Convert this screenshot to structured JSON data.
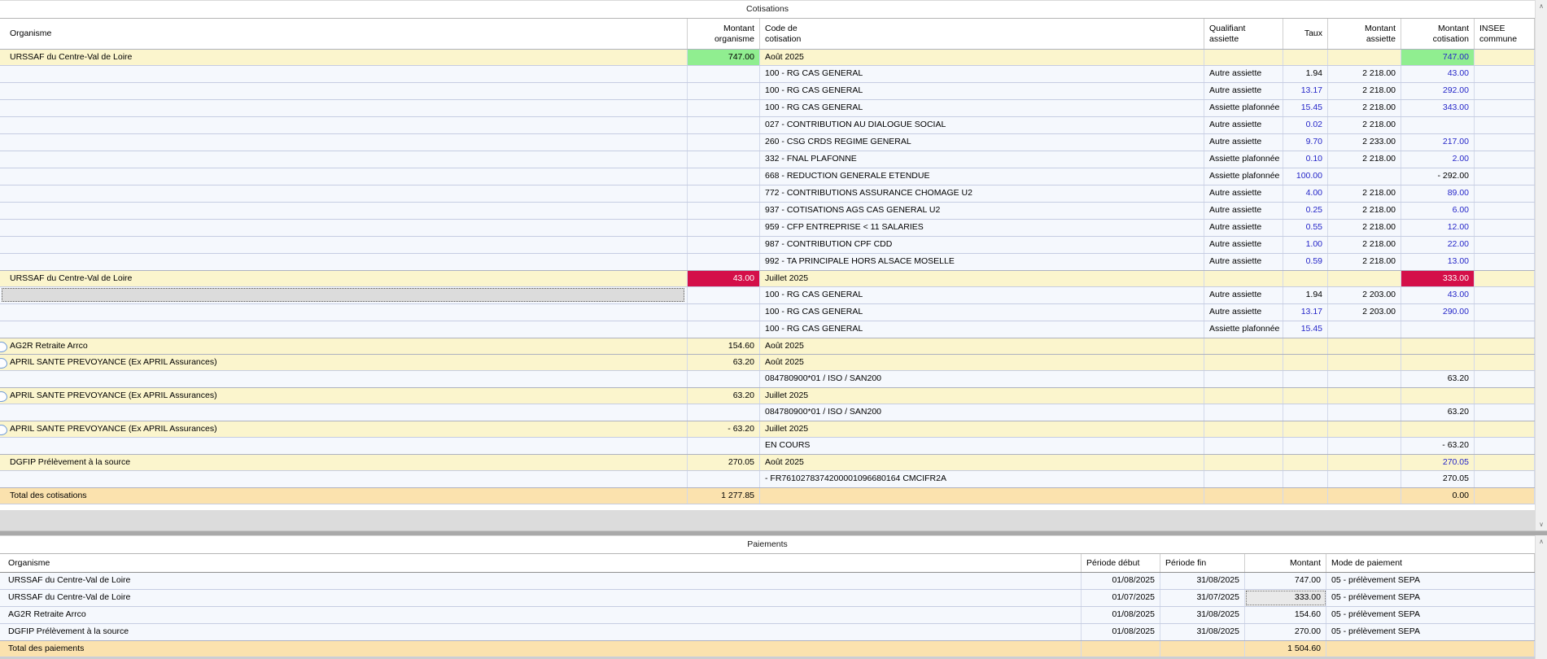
{
  "palette": {
    "group_row_bg": "#fbf5cd",
    "detail_row_bg": "#f5f8fd",
    "total_row_bg": "#fbe2ae",
    "highlight_green": "#90ee90",
    "highlight_red": "#d40f49",
    "number_blue": "#2425c8",
    "selected_cell_bg": "#dcdcdc",
    "row_border": "#c6cde2",
    "cell_border": "#d3d9ea"
  },
  "icons": {
    "scroll_up": "∧",
    "scroll_down": "∨"
  },
  "cotisations": {
    "title": "Cotisations",
    "headers": {
      "organisme": "Organisme",
      "montant_organisme": "Montant\norganisme",
      "code": "Code de\ncotisation",
      "qualifiant": "Qualifiant\nassiette",
      "taux": "Taux",
      "montant_assiette": "Montant\nassiette",
      "montant_cotisation": "Montant\ncotisation",
      "insee": "INSEE\ncommune"
    },
    "rows": [
      {
        "kind": "group",
        "organisme": "URSSAF du Centre-Val de Loire",
        "montant_organisme": "747.00",
        "mo_hl": "green",
        "code": "Août 2025",
        "montant_cotisation": "747.00",
        "mc_hl": "green",
        "mc_blue": true
      },
      {
        "kind": "detail",
        "code": "100 - RG CAS GENERAL",
        "qualifiant": "Autre assiette",
        "taux": "1.94",
        "montant_assiette": "2 218.00",
        "montant_cotisation": "43.00",
        "mc_blue": true
      },
      {
        "kind": "detail",
        "code": "100 - RG CAS GENERAL",
        "qualifiant": "Autre assiette",
        "taux": "13.17",
        "taux_blue": true,
        "montant_assiette": "2 218.00",
        "montant_cotisation": "292.00",
        "mc_blue": true
      },
      {
        "kind": "detail",
        "code": "100 - RG CAS GENERAL",
        "qualifiant": "Assiette plafonnée",
        "taux": "15.45",
        "taux_blue": true,
        "montant_assiette": "2 218.00",
        "montant_cotisation": "343.00",
        "mc_blue": true
      },
      {
        "kind": "detail",
        "code": "027 - CONTRIBUTION AU DIALOGUE SOCIAL",
        "qualifiant": "Autre assiette",
        "taux": "0.02",
        "taux_blue": true,
        "montant_assiette": "2 218.00"
      },
      {
        "kind": "detail",
        "code": "260 - CSG CRDS REGIME GENERAL",
        "qualifiant": "Autre assiette",
        "taux": "9.70",
        "taux_blue": true,
        "montant_assiette": "2 233.00",
        "montant_cotisation": "217.00",
        "mc_blue": true
      },
      {
        "kind": "detail",
        "code": "332 - FNAL PLAFONNE",
        "qualifiant": "Assiette plafonnée",
        "taux": "0.10",
        "taux_blue": true,
        "montant_assiette": "2 218.00",
        "montant_cotisation": "2.00",
        "mc_blue": true
      },
      {
        "kind": "detail",
        "code": "668 - REDUCTION GENERALE ETENDUE",
        "qualifiant": "Assiette plafonnée",
        "taux": "100.00",
        "taux_blue": true,
        "montant_cotisation": "- 292.00"
      },
      {
        "kind": "detail",
        "code": "772 - CONTRIBUTIONS ASSURANCE CHOMAGE U2",
        "qualifiant": "Autre assiette",
        "taux": "4.00",
        "taux_blue": true,
        "montant_assiette": "2 218.00",
        "montant_cotisation": "89.00",
        "mc_blue": true
      },
      {
        "kind": "detail",
        "code": "937 - COTISATIONS AGS CAS GENERAL U2",
        "qualifiant": "Autre assiette",
        "taux": "0.25",
        "taux_blue": true,
        "montant_assiette": "2 218.00",
        "montant_cotisation": "6.00",
        "mc_blue": true
      },
      {
        "kind": "detail",
        "code": "959 - CFP ENTREPRISE < 11 SALARIES",
        "qualifiant": "Autre assiette",
        "taux": "0.55",
        "taux_blue": true,
        "montant_assiette": "2 218.00",
        "montant_cotisation": "12.00",
        "mc_blue": true
      },
      {
        "kind": "detail",
        "code": "987 - CONTRIBUTION CPF CDD",
        "qualifiant": "Autre assiette",
        "taux": "1.00",
        "taux_blue": true,
        "montant_assiette": "2 218.00",
        "montant_cotisation": "22.00",
        "mc_blue": true
      },
      {
        "kind": "detail",
        "code": "992 - TA PRINCIPALE HORS ALSACE MOSELLE",
        "qualifiant": "Autre assiette",
        "taux": "0.59",
        "taux_blue": true,
        "montant_assiette": "2 218.00",
        "montant_cotisation": "13.00",
        "mc_blue": true
      },
      {
        "kind": "group",
        "organisme": "URSSAF du Centre-Val de Loire",
        "montant_organisme": "43.00",
        "mo_hl": "red",
        "code": "Juillet 2025",
        "montant_cotisation": "333.00",
        "mc_hl": "red"
      },
      {
        "kind": "detail",
        "selected": true,
        "code": "100 - RG CAS GENERAL",
        "qualifiant": "Autre assiette",
        "taux": "1.94",
        "montant_assiette": "2 203.00",
        "montant_cotisation": "43.00",
        "mc_blue": true
      },
      {
        "kind": "detail",
        "code": "100 - RG CAS GENERAL",
        "qualifiant": "Autre assiette",
        "taux": "13.17",
        "taux_blue": true,
        "montant_assiette": "2 203.00",
        "montant_cotisation": "290.00",
        "mc_blue": true
      },
      {
        "kind": "detail",
        "code": "100 - RG CAS GENERAL",
        "qualifiant": "Assiette plafonnée",
        "taux": "15.45",
        "taux_blue": true
      },
      {
        "kind": "group",
        "icon": true,
        "organisme": "AG2R Retraite Arrco",
        "montant_organisme": "154.60",
        "code": "Août 2025"
      },
      {
        "kind": "group",
        "icon": true,
        "organisme": "APRIL SANTE PREVOYANCE (Ex APRIL Assurances)",
        "montant_organisme": "63.20",
        "code": "Août 2025"
      },
      {
        "kind": "detail",
        "code": "084780900*01 / ISO / SAN200",
        "montant_cotisation": "63.20"
      },
      {
        "kind": "group",
        "icon": true,
        "organisme": "APRIL SANTE PREVOYANCE (Ex APRIL Assurances)",
        "montant_organisme": "63.20",
        "code": "Juillet 2025"
      },
      {
        "kind": "detail",
        "code": "084780900*01 / ISO / SAN200",
        "montant_cotisation": "63.20"
      },
      {
        "kind": "group",
        "icon": true,
        "organisme": "APRIL SANTE PREVOYANCE (Ex APRIL Assurances)",
        "montant_organisme": "- 63.20",
        "code": "Juillet 2025"
      },
      {
        "kind": "detail",
        "code": "EN COURS",
        "montant_cotisation": "- 63.20"
      },
      {
        "kind": "group",
        "organisme": "DGFIP Prélèvement à la source",
        "montant_organisme": "270.05",
        "code": "Août 2025",
        "montant_cotisation": "270.05",
        "mc_blue": true
      },
      {
        "kind": "detail",
        "code": "- FR7610278374200001096680164 CMCIFR2A",
        "montant_cotisation": "270.05"
      },
      {
        "kind": "total",
        "organisme": "Total des cotisations",
        "montant_organisme": "1 277.85",
        "montant_cotisation": "0.00"
      }
    ]
  },
  "paiements": {
    "title": "Paiements",
    "headers": {
      "organisme": "Organisme",
      "periode_debut": "Période début",
      "periode_fin": "Période fin",
      "montant": "Montant",
      "mode": "Mode de paiement"
    },
    "rows": [
      {
        "kind": "detail",
        "organisme": "URSSAF du Centre-Val de Loire",
        "periode_debut": "01/08/2025",
        "periode_fin": "31/08/2025",
        "montant": "747.00",
        "mode": "05 - prélèvement SEPA"
      },
      {
        "kind": "detail",
        "organisme": "URSSAF du Centre-Val de Loire",
        "periode_debut": "01/07/2025",
        "periode_fin": "31/07/2025",
        "montant": "333.00",
        "montant_focused": true,
        "mode": "05 - prélèvement SEPA"
      },
      {
        "kind": "detail",
        "organisme": "AG2R Retraite Arrco",
        "periode_debut": "01/08/2025",
        "periode_fin": "31/08/2025",
        "montant": "154.60",
        "mode": "05 - prélèvement SEPA"
      },
      {
        "kind": "detail",
        "organisme": "DGFIP Prélèvement à la source",
        "periode_debut": "01/08/2025",
        "periode_fin": "31/08/2025",
        "montant": "270.00",
        "mode": "05 - prélèvement SEPA"
      },
      {
        "kind": "total",
        "organisme": "Total des paiements",
        "montant": "1 504.60"
      }
    ]
  }
}
